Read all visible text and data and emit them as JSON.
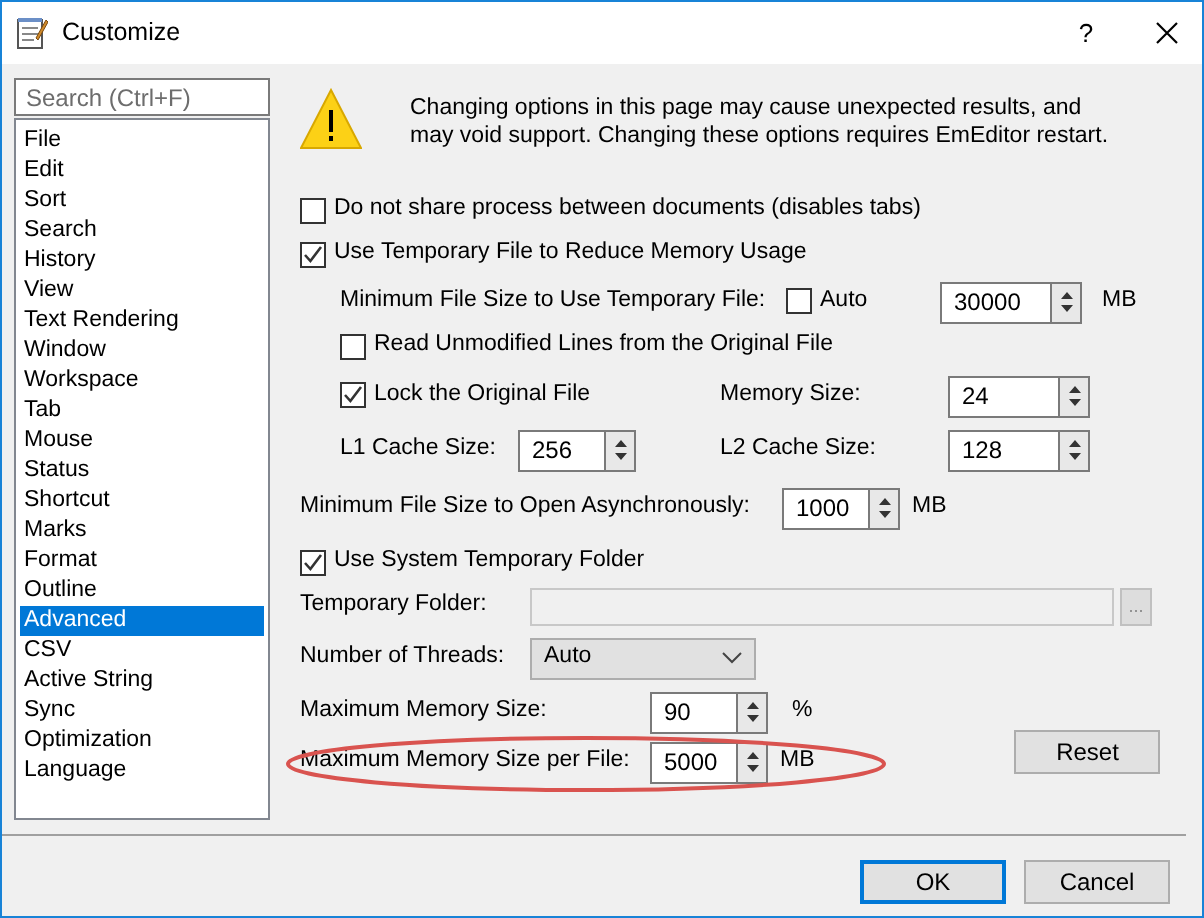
{
  "window": {
    "title": "Customize",
    "help": "?"
  },
  "sidebar": {
    "search_placeholder": "Search (Ctrl+F)",
    "items": [
      {
        "label": "File",
        "selected": false
      },
      {
        "label": "Edit",
        "selected": false
      },
      {
        "label": "Sort",
        "selected": false
      },
      {
        "label": "Search",
        "selected": false
      },
      {
        "label": "History",
        "selected": false
      },
      {
        "label": "View",
        "selected": false
      },
      {
        "label": "Text Rendering",
        "selected": false
      },
      {
        "label": "Window",
        "selected": false
      },
      {
        "label": "Workspace",
        "selected": false
      },
      {
        "label": "Tab",
        "selected": false
      },
      {
        "label": "Mouse",
        "selected": false
      },
      {
        "label": "Status",
        "selected": false
      },
      {
        "label": "Shortcut",
        "selected": false
      },
      {
        "label": "Marks",
        "selected": false
      },
      {
        "label": "Format",
        "selected": false
      },
      {
        "label": "Outline",
        "selected": false
      },
      {
        "label": "Advanced",
        "selected": true
      },
      {
        "label": "CSV",
        "selected": false
      },
      {
        "label": "Active String",
        "selected": false
      },
      {
        "label": "Sync",
        "selected": false
      },
      {
        "label": "Optimization",
        "selected": false
      },
      {
        "label": "Language",
        "selected": false
      }
    ]
  },
  "warning": "Changing options in this page may cause unexpected results, and may void support. Changing these options requires EmEditor restart.",
  "share_process": {
    "label": "Do not share process between documents (disables tabs)",
    "checked": false
  },
  "use_temp_file": {
    "label": "Use Temporary File to Reduce Memory Usage",
    "checked": true
  },
  "min_temp_size": {
    "label": "Minimum File Size to Use Temporary File:",
    "auto": {
      "label": "Auto",
      "checked": false
    },
    "value": "30000",
    "unit": "MB"
  },
  "read_unmodified": {
    "label": "Read Unmodified Lines from the Original File",
    "checked": false
  },
  "lock_original": {
    "label": "Lock the Original File",
    "checked": true
  },
  "memory_size": {
    "label": "Memory Size:",
    "value": "24"
  },
  "l1_cache": {
    "label": "L1 Cache Size:",
    "value": "256"
  },
  "l2_cache": {
    "label": "L2 Cache Size:",
    "value": "128"
  },
  "min_async": {
    "label": "Minimum File Size to Open Asynchronously:",
    "value": "1000",
    "unit": "MB"
  },
  "use_system_temp": {
    "label": "Use System Temporary Folder",
    "checked": true
  },
  "temp_folder": {
    "label": "Temporary Folder:",
    "disabled": true,
    "browse": "..."
  },
  "threads": {
    "label": "Number of Threads:",
    "value": "Auto"
  },
  "max_memory": {
    "label": "Maximum Memory Size:",
    "value": "90",
    "unit": "%"
  },
  "max_memory_per_file": {
    "label": "Maximum Memory Size per File:",
    "value": "5000",
    "unit": "MB",
    "highlighted": true
  },
  "reset": "Reset",
  "buttons": [
    {
      "label": "OK",
      "default": true
    },
    {
      "label": "Cancel",
      "default": false
    }
  ]
}
